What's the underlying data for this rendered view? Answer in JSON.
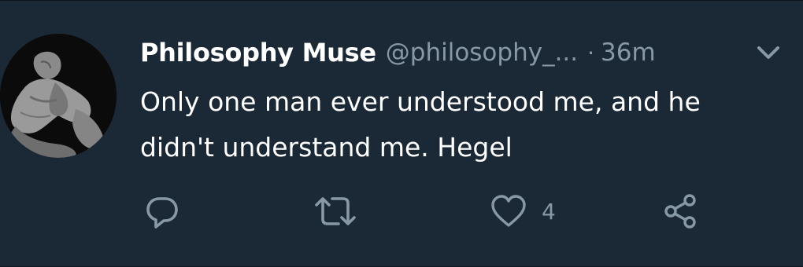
{
  "tweet": {
    "author_name": "Philosophy Muse",
    "handle": "@philosophy_...",
    "separator": "·",
    "timestamp": "36m",
    "text_line1": "Only one man ever understood me, and he",
    "text_line2": "didn't understand me. Hegel"
  },
  "actions": {
    "reply": {
      "icon": "reply-icon"
    },
    "retweet": {
      "icon": "retweet-icon"
    },
    "like": {
      "icon": "heart-icon",
      "count": "4"
    },
    "share": {
      "icon": "share-icon"
    }
  },
  "colors": {
    "background": "#1b2836",
    "text_primary": "#ffffff",
    "text_secondary": "#8899a6"
  }
}
